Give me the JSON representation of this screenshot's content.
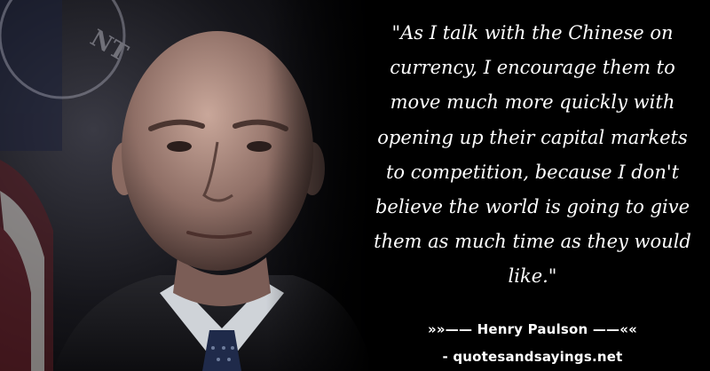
{
  "quote": {
    "text": "\"As I talk with the Chinese on currency, I encourage them to move much more quickly with opening up their capital markets to competition, because I don't believe the world is going to give them as much time as they would like.\"",
    "author_line": "»»—— Henry Paulson ——««",
    "source": "- quotesandsayings.net"
  },
  "colors": {
    "background": "#000000",
    "text": "#ffffff"
  }
}
